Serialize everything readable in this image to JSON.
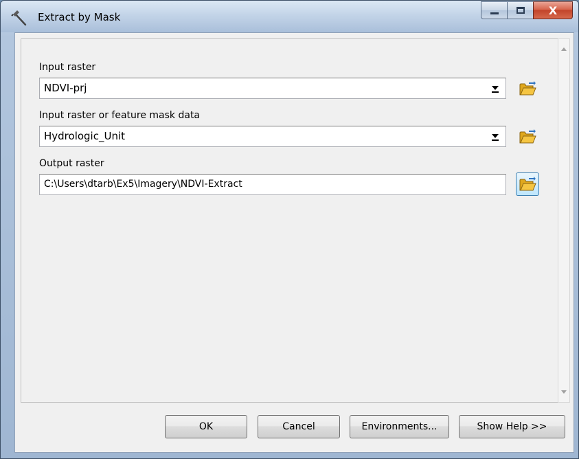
{
  "window": {
    "title": "Extract by Mask",
    "minimize_icon": "minimize-icon",
    "maximize_icon": "maximize-icon",
    "close_label": "X"
  },
  "fields": {
    "input_raster": {
      "label": "Input raster",
      "value": "NDVI-prj"
    },
    "mask_data": {
      "label": "Input raster or feature mask data",
      "value": "Hydrologic_Unit"
    },
    "output_raster": {
      "label": "Output raster",
      "value": "C:\\Users\\dtarb\\Ex5\\Imagery\\NDVI-Extract"
    }
  },
  "buttons": {
    "ok": "OK",
    "cancel": "Cancel",
    "environments": "Environments...",
    "show_help": "Show Help >>"
  },
  "icons": {
    "title": "hammer-icon",
    "browse": "open-folder-icon"
  },
  "colors": {
    "titlebar": "#c3d4e8",
    "close_button": "#c2442a",
    "dialog_bg": "#f0f0f0",
    "folder_yellow": "#f5c542"
  }
}
